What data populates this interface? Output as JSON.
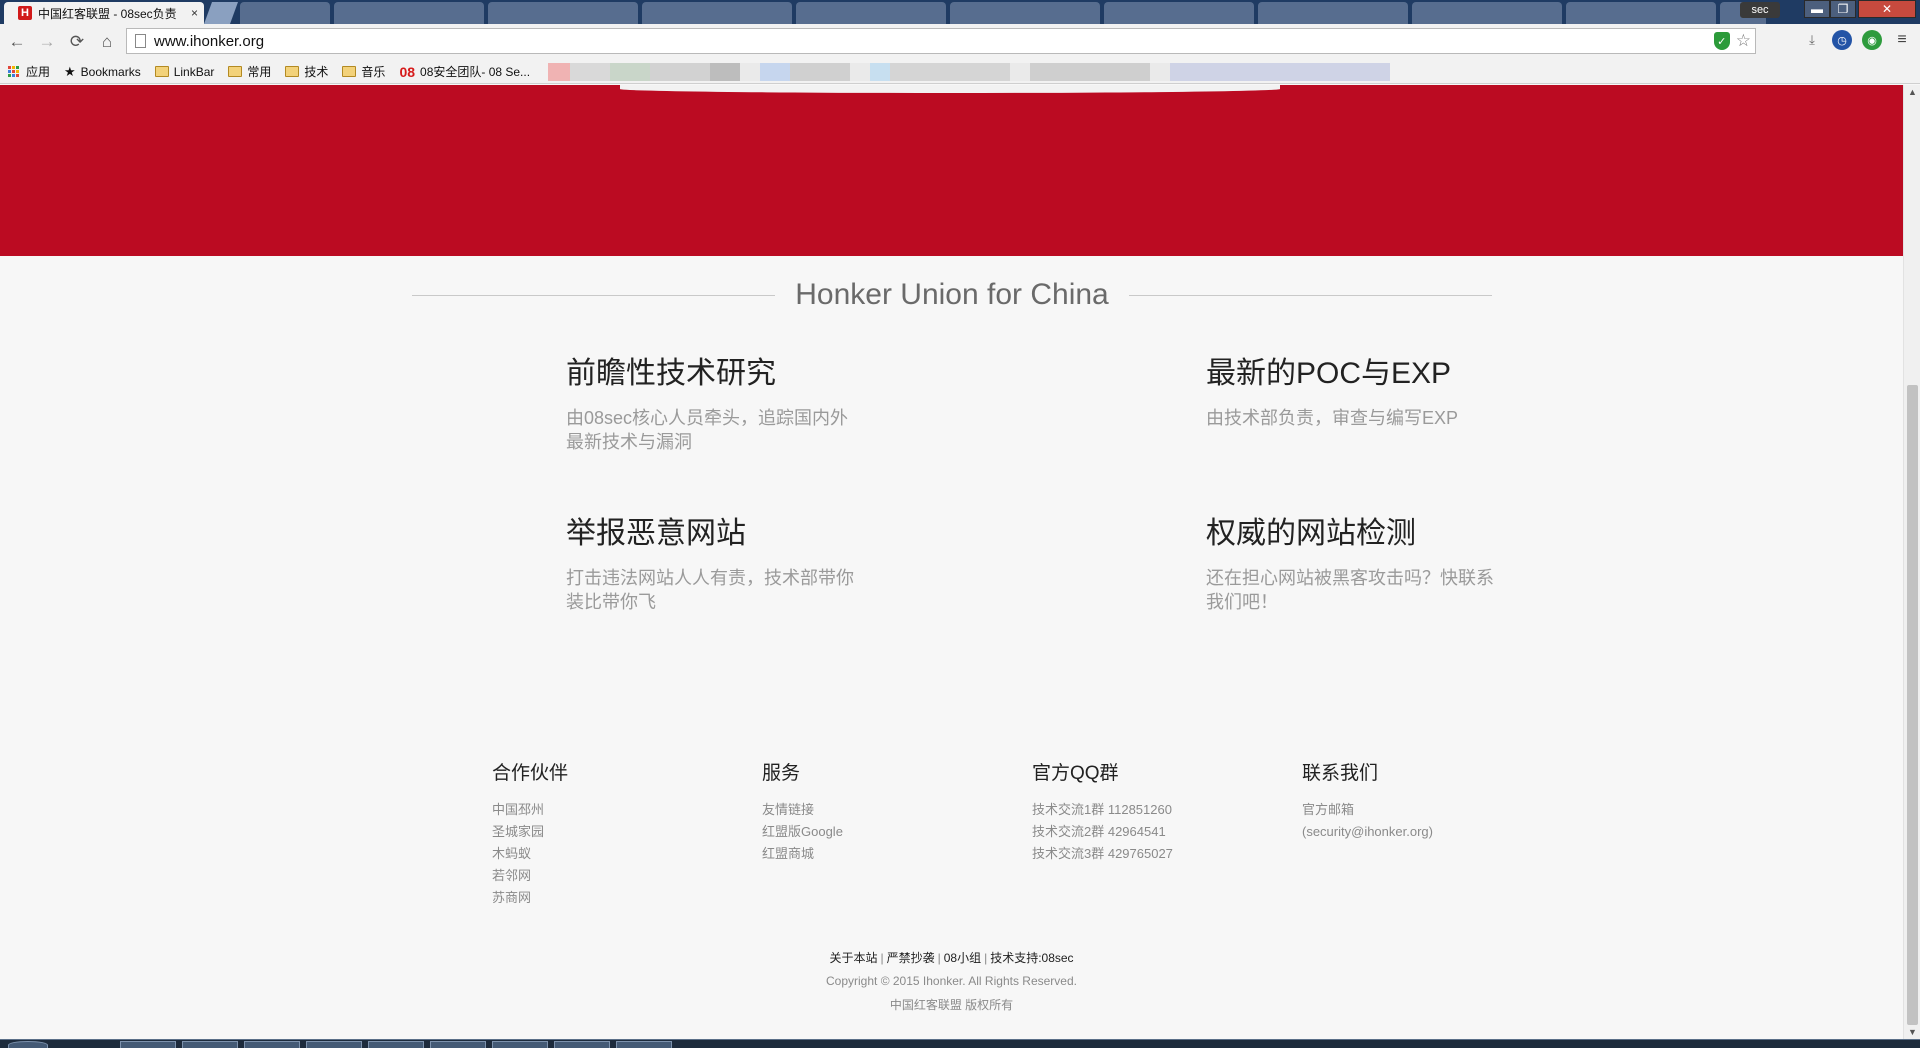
{
  "browser": {
    "tab_title": "中国红客联盟 - 08sec负责",
    "tab_close": "×",
    "favicon_letter": "H",
    "profile_label": "sec",
    "window_controls": {
      "minimize": "▬",
      "maximize": "❐",
      "close": "✕"
    },
    "url": "www.ihonker.org",
    "nav": {
      "back": "←",
      "forward": "→",
      "reload": "⟳",
      "home": "⌂"
    },
    "star": "☆",
    "menu": "≡"
  },
  "bookmarks": [
    {
      "label": "应用",
      "icon": "apps-icon"
    },
    {
      "label": "Bookmarks",
      "icon": "star-icon"
    },
    {
      "label": "LinkBar",
      "icon": "folder-icon"
    },
    {
      "label": "常用",
      "icon": "folder-icon"
    },
    {
      "label": "技术",
      "icon": "folder-icon"
    },
    {
      "label": "音乐",
      "icon": "folder-icon"
    },
    {
      "label": "08安全团队- 08 Se...",
      "icon": "08-icon"
    }
  ],
  "page": {
    "section_title": "Honker Union for China",
    "features": [
      {
        "title": "前瞻性技术研究",
        "desc": "由08sec核心人员牵头，追踪国内外最新技术与漏洞"
      },
      {
        "title": "最新的POC与EXP",
        "desc": "由技术部负责，审查与编写EXP"
      },
      {
        "title": "举报恶意网站",
        "desc": "打击违法网站人人有责，技术部带你装比带你飞"
      },
      {
        "title": "权威的网站检测",
        "desc": "还在担心网站被黑客攻击吗？快联系我们吧！"
      }
    ],
    "footer": {
      "columns": [
        {
          "heading": "合作伙伴",
          "links": [
            "中国邳州",
            "圣城家园",
            "木蚂蚁",
            "若邻网",
            "苏商网"
          ]
        },
        {
          "heading": "服务",
          "links": [
            "友情链接",
            "红盟版Google",
            "红盟商城"
          ]
        },
        {
          "heading": "官方QQ群",
          "links": [
            "技术交流1群 112851260",
            "技术交流2群 42964541",
            "技术交流3群 429765027"
          ]
        },
        {
          "heading": "联系我们",
          "links": [
            "官方邮箱",
            "(security@ihonker.org)"
          ]
        }
      ],
      "bottom_links": [
        "关于本站",
        "严禁抄袭",
        "08小组",
        "技术支持:08sec"
      ],
      "copyright": "Copyright © 2015 Ihonker. All Rights Reserved.",
      "rights": "中国红客联盟 版权所有"
    }
  },
  "colors": {
    "hero": "#bb0b22",
    "page_bg": "#f7f7f7"
  }
}
